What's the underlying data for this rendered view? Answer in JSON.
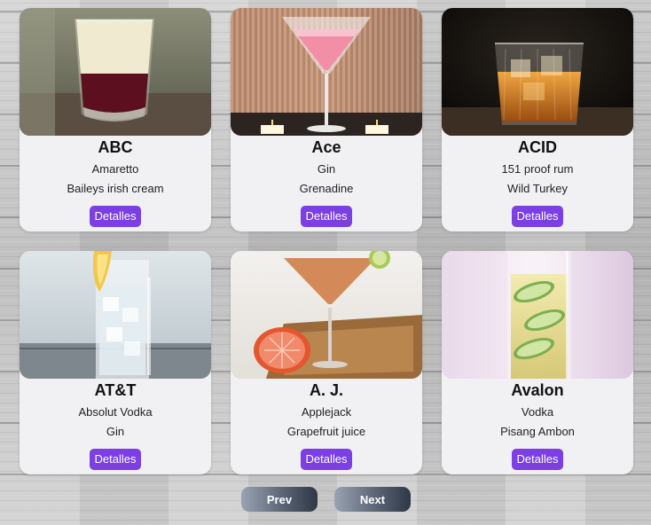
{
  "cards": [
    {
      "name": "ABC",
      "ingredients": [
        "Amaretto",
        "Baileys irish cream"
      ],
      "button": "Detalles",
      "image_icon": "shot-glass-layered-icon"
    },
    {
      "name": "Ace",
      "ingredients": [
        "Gin",
        "Grenadine"
      ],
      "button": "Detalles",
      "image_icon": "martini-pink-icon"
    },
    {
      "name": "ACID",
      "ingredients": [
        "151 proof rum",
        "Wild Turkey"
      ],
      "button": "Detalles",
      "image_icon": "whiskey-rocks-icon"
    },
    {
      "name": "AT&T",
      "ingredients": [
        "Absolut Vodka",
        "Gin"
      ],
      "button": "Detalles",
      "image_icon": "highball-lemon-icon"
    },
    {
      "name": "A. J.",
      "ingredients": [
        "Applejack",
        "Grapefruit juice"
      ],
      "button": "Detalles",
      "image_icon": "martini-grapefruit-icon"
    },
    {
      "name": "Avalon",
      "ingredients": [
        "Vodka",
        "Pisang Ambon"
      ],
      "button": "Detalles",
      "image_icon": "highball-cucumber-icon"
    }
  ],
  "pagination": {
    "prev_label": "Prev",
    "next_label": "Next"
  },
  "colors": {
    "button_accent": "#7b3fe4",
    "card_background": "#f1f1f4",
    "pager_gradient_start": "#9aa3b1",
    "pager_gradient_end": "#2f3846"
  }
}
